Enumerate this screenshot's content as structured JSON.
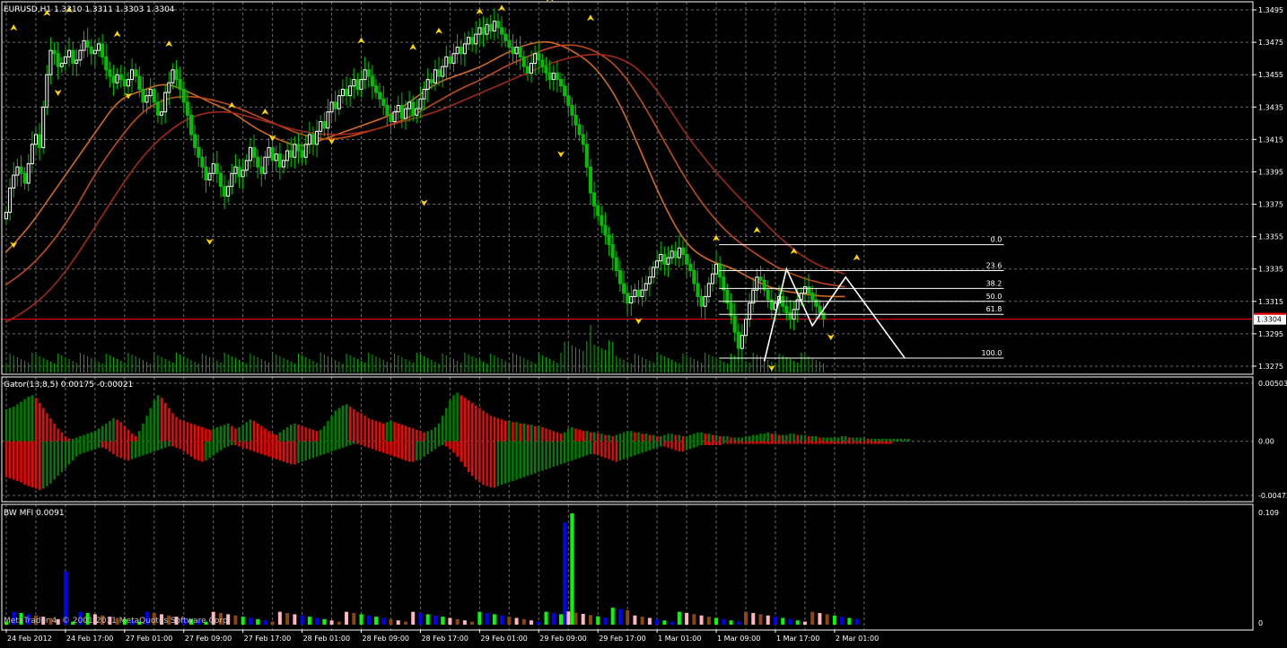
{
  "chart_data": [
    {
      "type": "candlestick",
      "title": "EURUSD,H1  1.3310 1.3311 1.3303 1.3304",
      "symbol": "EURUSD",
      "timeframe": "H1",
      "ohlc_last": {
        "open": 1.331,
        "high": 1.3311,
        "low": 1.3303,
        "close": 1.3304
      },
      "ylim": [
        1.327,
        1.35
      ],
      "y_ticks": [
        1.3495,
        1.3475,
        1.3455,
        1.3435,
        1.3415,
        1.3395,
        1.3375,
        1.3355,
        1.3335,
        1.3315,
        1.3295,
        1.3275
      ],
      "y_tick_labels": [
        "1.3495",
        "1.3475",
        "1.3455",
        "1.3435",
        "1.3415",
        "1.3395",
        "1.3375",
        "1.3355",
        "1.3335",
        "1.3315",
        "1.3295",
        "1.3275"
      ],
      "current_price": 1.3304,
      "current_price_label": "1.3304",
      "price_line_color": "#ff0000",
      "bull_color": "#ffffff",
      "bear_color": "#00c000",
      "grid": true,
      "x_labels": [
        "24 Feb 2012",
        "24 Feb 17:00",
        "27 Feb 01:00",
        "27 Feb 09:00",
        "27 Feb 17:00",
        "28 Feb 01:00",
        "28 Feb 09:00",
        "28 Feb 17:00",
        "29 Feb 01:00",
        "29 Feb 09:00",
        "29 Feb 17:00",
        "1 Mar 01:00",
        "1 Mar 09:00",
        "1 Mar 17:00",
        "2 Mar 01:00"
      ],
      "x_label_bars": [
        0,
        16,
        32,
        48,
        64,
        80,
        96,
        112,
        128,
        144,
        160,
        176,
        192,
        208,
        224
      ],
      "close_series": [
        1.337,
        1.3385,
        1.3393,
        1.3398,
        1.3394,
        1.3388,
        1.34,
        1.3412,
        1.3418,
        1.341,
        1.3435,
        1.3455,
        1.347,
        1.3468,
        1.346,
        1.3462,
        1.3466,
        1.347,
        1.3462,
        1.3464,
        1.347,
        1.3476,
        1.3472,
        1.3468,
        1.347,
        1.3474,
        1.3466,
        1.3458,
        1.3454,
        1.345,
        1.3455,
        1.3452,
        1.3448,
        1.3452,
        1.3458,
        1.3454,
        1.3446,
        1.3438,
        1.3442,
        1.3446,
        1.3438,
        1.343,
        1.3432,
        1.3444,
        1.345,
        1.3458,
        1.3452,
        1.3446,
        1.3438,
        1.343,
        1.3418,
        1.341,
        1.3404,
        1.3398,
        1.339,
        1.3394,
        1.34,
        1.3394,
        1.3386,
        1.338,
        1.3386,
        1.3394,
        1.3398,
        1.3392,
        1.3396,
        1.3402,
        1.341,
        1.3404,
        1.3398,
        1.3394,
        1.3404,
        1.341,
        1.3402,
        1.3406,
        1.3398,
        1.3402,
        1.3408,
        1.3404,
        1.3412,
        1.3408,
        1.3404,
        1.3412,
        1.3418,
        1.3412,
        1.342,
        1.3426,
        1.3422,
        1.3432,
        1.3438,
        1.3434,
        1.3442,
        1.3446,
        1.3442,
        1.3448,
        1.3452,
        1.3446,
        1.3452,
        1.3458,
        1.3454,
        1.3448,
        1.3444,
        1.344,
        1.3436,
        1.343,
        1.3426,
        1.3432,
        1.3436,
        1.3428,
        1.3434,
        1.3438,
        1.343,
        1.3434,
        1.344,
        1.3446,
        1.3452,
        1.345,
        1.3458,
        1.3454,
        1.346,
        1.3466,
        1.3462,
        1.3468,
        1.3472,
        1.3468,
        1.3474,
        1.3478,
        1.3474,
        1.348,
        1.3484,
        1.348,
        1.3486,
        1.3482,
        1.3488,
        1.3484,
        1.348,
        1.3476,
        1.3472,
        1.3468,
        1.3472,
        1.3466,
        1.346,
        1.3456,
        1.3462,
        1.3468,
        1.3464,
        1.346,
        1.3456,
        1.3452,
        1.3456,
        1.3452,
        1.3448,
        1.3442,
        1.3436,
        1.343,
        1.3424,
        1.3418,
        1.3412,
        1.3398,
        1.3382,
        1.3374,
        1.3368,
        1.3362,
        1.3356,
        1.335,
        1.3342,
        1.3334,
        1.3326,
        1.332,
        1.3314,
        1.3318,
        1.3322,
        1.3318,
        1.3322,
        1.3326,
        1.333,
        1.3336,
        1.334,
        1.3344,
        1.3338,
        1.3342,
        1.3346,
        1.3342,
        1.3348,
        1.3344,
        1.3338,
        1.3334,
        1.3326,
        1.3318,
        1.3312,
        1.3318,
        1.3326,
        1.3332,
        1.3338,
        1.333,
        1.3322,
        1.3314,
        1.3306,
        1.3296,
        1.3286,
        1.3294,
        1.3304,
        1.3314,
        1.3322,
        1.333,
        1.3328,
        1.3322,
        1.3316,
        1.331,
        1.3314,
        1.3318,
        1.3312,
        1.3308,
        1.3304,
        1.331,
        1.3316,
        1.332,
        1.3324,
        1.332,
        1.3316,
        1.3312,
        1.3308,
        1.3304
      ],
      "fractal_up": [
        [
          2,
          1.348
        ],
        [
          11,
          1.3489
        ],
        [
          17,
          1.3491
        ],
        [
          30,
          1.3476
        ],
        [
          44,
          1.347
        ],
        [
          61,
          1.3432
        ],
        [
          70,
          1.3428
        ],
        [
          96,
          1.3472
        ],
        [
          110,
          1.3468
        ],
        [
          117,
          1.3478
        ],
        [
          128,
          1.349
        ],
        [
          134,
          1.3492
        ],
        [
          147,
          1.3498
        ],
        [
          158,
          1.3486
        ],
        [
          192,
          1.335
        ],
        [
          203,
          1.3355
        ],
        [
          213,
          1.3342
        ],
        [
          230,
          1.3338
        ]
      ],
      "fractal_down": [
        [
          2,
          1.3354
        ],
        [
          14,
          1.3448
        ],
        [
          33,
          1.3446
        ],
        [
          55,
          1.3356
        ],
        [
          72,
          1.342
        ],
        [
          88,
          1.3418
        ],
        [
          113,
          1.338
        ],
        [
          150,
          1.341
        ],
        [
          171,
          1.3307
        ],
        [
          207,
          1.3278
        ],
        [
          223,
          1.3297
        ]
      ],
      "moving_averages": [
        {
          "name": "MA1",
          "color": "#d2691e",
          "values": [
            1.3345,
            1.336,
            1.338,
            1.34,
            1.342,
            1.344,
            1.3445,
            1.345,
            1.3445,
            1.3438,
            1.3432,
            1.3422,
            1.3415,
            1.341,
            1.3415,
            1.342,
            1.3425,
            1.343,
            1.344,
            1.345,
            1.3455,
            1.346,
            1.3468,
            1.3474,
            1.3476,
            1.347,
            1.346,
            1.344,
            1.3408,
            1.3375,
            1.335,
            1.334,
            1.3336,
            1.3328,
            1.3322,
            1.332,
            1.3318,
            1.3318
          ]
        },
        {
          "name": "MA2",
          "color": "#c04a1a",
          "values": [
            1.3325,
            1.3335,
            1.335,
            1.337,
            1.3395,
            1.3415,
            1.3432,
            1.344,
            1.3442,
            1.344,
            1.3436,
            1.343,
            1.3424,
            1.3418,
            1.3415,
            1.3416,
            1.342,
            1.3424,
            1.343,
            1.3438,
            1.3446,
            1.3452,
            1.346,
            1.3466,
            1.3472,
            1.3474,
            1.347,
            1.346,
            1.344,
            1.3415,
            1.339,
            1.337,
            1.3355,
            1.3345,
            1.3336,
            1.333,
            1.3326,
            1.3324
          ]
        },
        {
          "name": "MA3",
          "color": "#a0281a",
          "values": [
            1.3302,
            1.331,
            1.3322,
            1.334,
            1.3362,
            1.3384,
            1.3404,
            1.3418,
            1.3428,
            1.3432,
            1.3432,
            1.3428,
            1.3424,
            1.342,
            1.3418,
            1.3418,
            1.342,
            1.3424,
            1.3428,
            1.3432,
            1.3438,
            1.3444,
            1.345,
            1.3456,
            1.3462,
            1.3466,
            1.3468,
            1.3466,
            1.3458,
            1.344,
            1.3418,
            1.34,
            1.3384,
            1.337,
            1.3356,
            1.3344,
            1.3336,
            1.3332
          ]
        }
      ],
      "fibonacci": {
        "high": 1.335,
        "low": 1.328,
        "levels": [
          {
            "label": "0.0",
            "price": 1.335
          },
          {
            "label": "23.6",
            "price": 1.3334
          },
          {
            "label": "38.2",
            "price": 1.3323
          },
          {
            "label": "50.0",
            "price": 1.3315
          },
          {
            "label": "61.8",
            "price": 1.3307
          },
          {
            "label": "100.0",
            "price": 1.328
          }
        ]
      },
      "zigzag": [
        [
          205,
          1.3278
        ],
        [
          211,
          1.3335
        ],
        [
          218,
          1.33
        ],
        [
          227,
          1.333
        ],
        [
          243,
          1.328
        ]
      ]
    },
    {
      "type": "bar",
      "title": "Gator(13,8,5) 0.00175 -0.00021",
      "y_tick_labels": [
        "0.00503",
        "0.00",
        "-0.00472"
      ],
      "ylim": [
        -0.00472,
        0.00503
      ],
      "colors": {
        "up": "#008000",
        "down": "#ff0000"
      },
      "upper_values": [
        0.0025,
        0.0026,
        0.0027,
        0.0029,
        0.0031,
        0.0033,
        0.0035,
        0.0036,
        0.0034,
        0.003,
        0.0026,
        0.0022,
        0.0018,
        0.0014,
        0.001,
        0.0007,
        0.0004,
        0.0002,
        0.0002,
        0.0003,
        0.0004,
        0.0005,
        0.0006,
        0.0007,
        0.0008,
        0.001,
        0.0012,
        0.0014,
        0.0016,
        0.0018,
        0.0017,
        0.0015,
        0.0012,
        0.0009,
        0.0006,
        0.0004,
        0.0008,
        0.0014,
        0.002,
        0.0026,
        0.0032,
        0.0036,
        0.0034,
        0.003,
        0.0026,
        0.0022,
        0.0019,
        0.0017,
        0.0016,
        0.0015,
        0.0014,
        0.0013,
        0.0012,
        0.0011,
        0.001,
        0.0009,
        0.001,
        0.0011,
        0.0012,
        0.0013,
        0.0014,
        0.0012,
        0.001,
        0.0011,
        0.0013,
        0.0015,
        0.0017,
        0.0016,
        0.0014,
        0.0012,
        0.001,
        0.0008,
        0.0006,
        0.0005,
        0.0007,
        0.0009,
        0.0011,
        0.0013,
        0.0014,
        0.0013,
        0.0012,
        0.0011,
        0.001,
        0.0009,
        0.0008,
        0.0009,
        0.0012,
        0.0016,
        0.002,
        0.0024,
        0.0026,
        0.0028,
        0.0029,
        0.0027,
        0.0025,
        0.0023,
        0.0022,
        0.002,
        0.0018,
        0.0017,
        0.0016,
        0.0015,
        0.0014,
        0.0015,
        0.0016,
        0.0015,
        0.0014,
        0.0013,
        0.0012,
        0.0011,
        0.001,
        0.0009,
        0.0008,
        0.0007,
        0.0008,
        0.0009,
        0.0011,
        0.0014,
        0.002,
        0.0026,
        0.0032,
        0.0036,
        0.0038,
        0.0036,
        0.0034,
        0.0032,
        0.003,
        0.0028,
        0.0026,
        0.0024,
        0.0022,
        0.002,
        0.0019,
        0.0018,
        0.0017,
        0.0016,
        0.0016,
        0.0015,
        0.0015,
        0.0014,
        0.0014,
        0.0013,
        0.0013,
        0.0012,
        0.0012,
        0.0011,
        0.001,
        0.0009,
        0.0008,
        0.0007,
        0.0006,
        0.0007,
        0.001,
        0.0011,
        0.001,
        0.0009,
        0.0008,
        0.0008,
        0.0007,
        0.0007,
        0.0006,
        0.0006,
        0.0005,
        0.0005,
        0.0004,
        0.0005,
        0.0006,
        0.0007,
        0.0008,
        0.0008,
        0.0007,
        0.0007,
        0.0006,
        0.0006,
        0.0005,
        0.0005,
        0.0004,
        0.0004,
        0.0005,
        0.0006,
        0.0006,
        0.0005,
        0.0005,
        0.0004,
        0.0004,
        0.0005,
        0.0006,
        0.0007,
        0.0007,
        0.0006,
        0.0006,
        0.0005,
        0.0005,
        0.0004,
        0.0004,
        0.0004,
        0.0003,
        0.0003,
        0.0003,
        0.0003,
        0.0004,
        0.0004,
        0.0005,
        0.0005,
        0.0006,
        0.0006,
        0.0007,
        0.0006,
        0.0006,
        0.0005,
        0.0005,
        0.0005,
        0.0006,
        0.0006,
        0.0005,
        0.0005,
        0.0005,
        0.0004,
        0.0004,
        0.0004,
        0.0003,
        0.0003,
        0.0003,
        0.0003,
        0.0003,
        0.0003,
        0.0004,
        0.0004,
        0.0003,
        0.0003,
        0.0003,
        0.0003,
        0.0003,
        0.0002,
        0.0002,
        0.0002,
        0.0002,
        0.0002,
        0.0002,
        0.0002,
        0.0002,
        0.0002,
        0.0002,
        0.0002,
        0.0002
      ],
      "lower_values": [
        -0.0028,
        -0.0029,
        -0.003,
        -0.0031,
        -0.0032,
        -0.0034,
        -0.0035,
        -0.0036,
        -0.0037,
        -0.0038,
        -0.0037,
        -0.0035,
        -0.0033,
        -0.003,
        -0.0027,
        -0.0024,
        -0.0021,
        -0.0018,
        -0.0015,
        -0.0012,
        -0.001,
        -0.0009,
        -0.0008,
        -0.0007,
        -0.0006,
        -0.0005,
        -0.0005,
        -0.0006,
        -0.0008,
        -0.001,
        -0.0012,
        -0.0013,
        -0.0014,
        -0.0015,
        -0.0014,
        -0.0013,
        -0.0012,
        -0.0011,
        -0.001,
        -0.0009,
        -0.0008,
        -0.0007,
        -0.0006,
        -0.0005,
        -0.0004,
        -0.0004,
        -0.0005,
        -0.0006,
        -0.0008,
        -0.001,
        -0.0012,
        -0.0014,
        -0.0015,
        -0.0016,
        -0.0015,
        -0.0013,
        -0.0011,
        -0.0009,
        -0.0007,
        -0.0005,
        -0.0004,
        -0.0003,
        -0.0003,
        -0.0004,
        -0.0005,
        -0.0006,
        -0.0007,
        -0.0008,
        -0.0009,
        -0.001,
        -0.0011,
        -0.0012,
        -0.0013,
        -0.0014,
        -0.0015,
        -0.0016,
        -0.0017,
        -0.0018,
        -0.0018,
        -0.0017,
        -0.0016,
        -0.0015,
        -0.0014,
        -0.0013,
        -0.0012,
        -0.0011,
        -0.001,
        -0.0009,
        -0.0008,
        -0.0007,
        -0.0006,
        -0.0005,
        -0.0004,
        -0.0003,
        -0.0002,
        -0.0002,
        -0.0003,
        -0.0004,
        -0.0005,
        -0.0006,
        -0.0007,
        -0.0008,
        -0.0009,
        -0.001,
        -0.0011,
        -0.0012,
        -0.0013,
        -0.0014,
        -0.0015,
        -0.0016,
        -0.0016,
        -0.0015,
        -0.0014,
        -0.0012,
        -0.001,
        -0.0008,
        -0.0006,
        -0.0004,
        -0.0003,
        -0.0004,
        -0.0006,
        -0.0009,
        -0.0012,
        -0.0016,
        -0.002,
        -0.0024,
        -0.0027,
        -0.003,
        -0.0032,
        -0.0034,
        -0.0035,
        -0.0036,
        -0.0036,
        -0.0035,
        -0.0034,
        -0.0033,
        -0.0032,
        -0.0031,
        -0.003,
        -0.0029,
        -0.0028,
        -0.0027,
        -0.0026,
        -0.0025,
        -0.0024,
        -0.0023,
        -0.0022,
        -0.0021,
        -0.002,
        -0.0019,
        -0.0018,
        -0.0017,
        -0.0016,
        -0.0015,
        -0.0014,
        -0.0013,
        -0.0012,
        -0.0011,
        -0.001,
        -0.001,
        -0.0011,
        -0.0012,
        -0.0013,
        -0.0014,
        -0.0015,
        -0.0016,
        -0.0015,
        -0.0014,
        -0.0013,
        -0.0012,
        -0.0011,
        -0.001,
        -0.0009,
        -0.0008,
        -0.0007,
        -0.0006,
        -0.0005,
        -0.0004,
        -0.0004,
        -0.0005,
        -0.0006,
        -0.0007,
        -0.0008,
        -0.0008,
        -0.0007,
        -0.0006,
        -0.0005,
        -0.0004,
        -0.0003,
        -0.0003,
        -0.0003,
        -0.0003,
        -0.0003,
        -0.0003,
        -0.0002,
        -0.0002,
        -0.0002,
        -0.0002,
        -0.0002,
        -0.0002,
        -0.0002,
        -0.0002,
        -0.0002,
        -0.0002,
        -0.0002,
        -0.0002,
        -0.0002,
        -0.0002,
        -0.0002,
        -0.0002,
        -0.0002,
        -0.0002,
        -0.0002,
        -0.0002,
        -0.0002,
        -0.0002,
        -0.0002,
        -0.0002,
        -0.0002,
        -0.0002,
        -0.0002,
        -0.0002,
        -0.0002,
        -0.0002,
        -0.0002,
        -0.0002,
        -0.0002,
        -0.0002,
        -0.0002,
        -0.0002,
        -0.0002,
        -0.0002,
        -0.0002,
        -0.0002,
        -0.0002,
        -0.0002,
        -0.0002,
        -0.0002,
        -0.0002,
        -0.0002
      ]
    },
    {
      "type": "bar",
      "title": "BW MFI 0.0091",
      "y_tick_labels": [
        "0.109",
        "0"
      ],
      "ylim": [
        0,
        0.109
      ],
      "colors": {
        "green": "#00ff00",
        "brown": "#8b4513",
        "blue": "#0000ff",
        "pink": "#ffb6c1"
      },
      "highlight_bars": [
        {
          "bar": 16,
          "value": 0.052,
          "color": "blue"
        },
        {
          "bar": 151,
          "value": 0.1,
          "color": "blue"
        },
        {
          "bar": 153,
          "value": 0.109,
          "color": "green"
        }
      ]
    }
  ],
  "footer": {
    "copyright": "MetaTrader 4, © 2001-2011 MetaQuotes Software Corp."
  }
}
